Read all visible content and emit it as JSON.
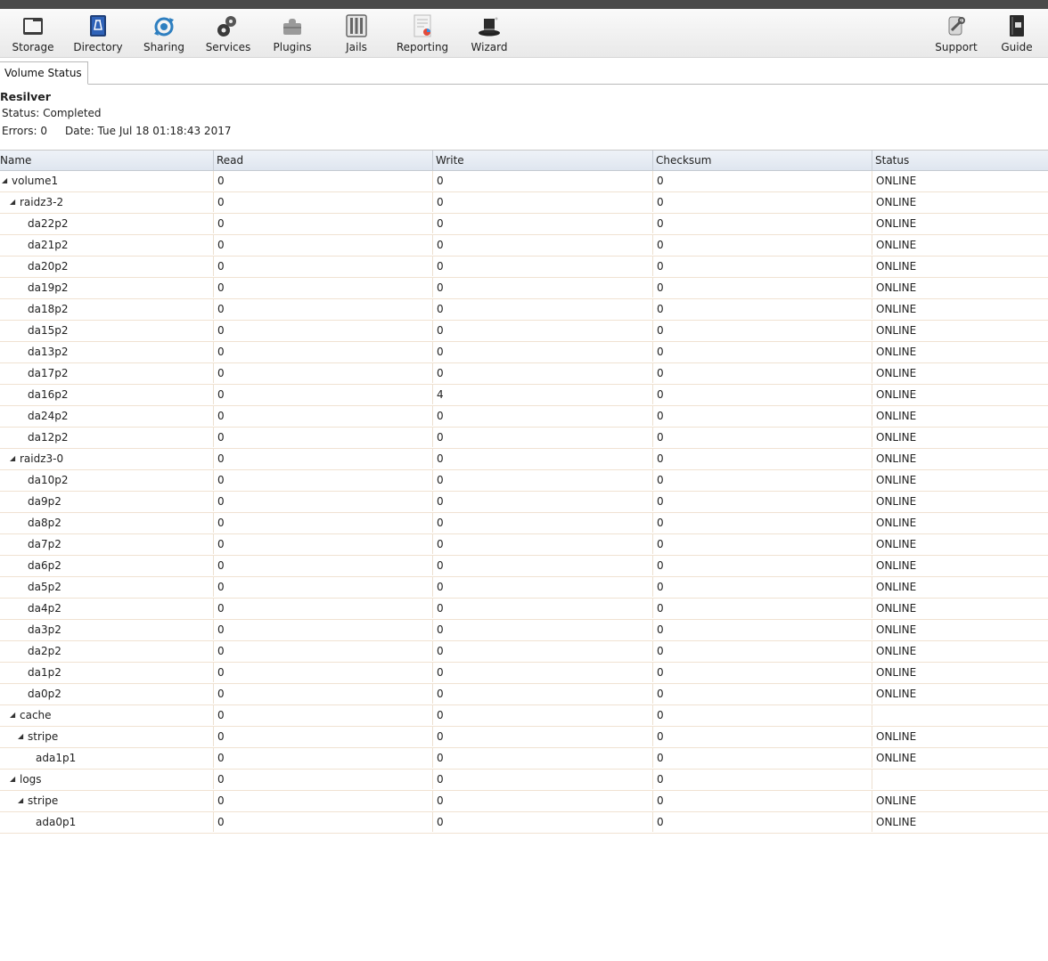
{
  "toolbar": {
    "left": [
      {
        "label": "Storage",
        "icon": "storage-icon"
      },
      {
        "label": "Directory",
        "icon": "directory-icon"
      },
      {
        "label": "Sharing",
        "icon": "sharing-icon"
      },
      {
        "label": "Services",
        "icon": "services-icon"
      },
      {
        "label": "Plugins",
        "icon": "plugins-icon"
      },
      {
        "label": "Jails",
        "icon": "jails-icon"
      },
      {
        "label": "Reporting",
        "icon": "reporting-icon"
      },
      {
        "label": "Wizard",
        "icon": "wizard-icon"
      }
    ],
    "right": [
      {
        "label": "Support",
        "icon": "support-icon"
      },
      {
        "label": "Guide",
        "icon": "guide-icon"
      }
    ]
  },
  "tab": {
    "label": "Volume Status"
  },
  "resilver": {
    "title": "Resilver",
    "status": "Status: Completed",
    "errors": "Errors: 0",
    "date": "Date: Tue Jul 18 01:18:43 2017"
  },
  "table": {
    "columns": [
      "Name",
      "Read",
      "Write",
      "Checksum",
      "Status"
    ],
    "rows": [
      {
        "name": "volume1",
        "depth": 0,
        "expandable": true,
        "read": "0",
        "write": "0",
        "checksum": "0",
        "status": "ONLINE"
      },
      {
        "name": "raidz3-2",
        "depth": 1,
        "expandable": true,
        "read": "0",
        "write": "0",
        "checksum": "0",
        "status": "ONLINE"
      },
      {
        "name": "da22p2",
        "depth": 2,
        "expandable": false,
        "read": "0",
        "write": "0",
        "checksum": "0",
        "status": "ONLINE"
      },
      {
        "name": "da21p2",
        "depth": 2,
        "expandable": false,
        "read": "0",
        "write": "0",
        "checksum": "0",
        "status": "ONLINE"
      },
      {
        "name": "da20p2",
        "depth": 2,
        "expandable": false,
        "read": "0",
        "write": "0",
        "checksum": "0",
        "status": "ONLINE"
      },
      {
        "name": "da19p2",
        "depth": 2,
        "expandable": false,
        "read": "0",
        "write": "0",
        "checksum": "0",
        "status": "ONLINE"
      },
      {
        "name": "da18p2",
        "depth": 2,
        "expandable": false,
        "read": "0",
        "write": "0",
        "checksum": "0",
        "status": "ONLINE"
      },
      {
        "name": "da15p2",
        "depth": 2,
        "expandable": false,
        "read": "0",
        "write": "0",
        "checksum": "0",
        "status": "ONLINE"
      },
      {
        "name": "da13p2",
        "depth": 2,
        "expandable": false,
        "read": "0",
        "write": "0",
        "checksum": "0",
        "status": "ONLINE"
      },
      {
        "name": "da17p2",
        "depth": 2,
        "expandable": false,
        "read": "0",
        "write": "0",
        "checksum": "0",
        "status": "ONLINE"
      },
      {
        "name": "da16p2",
        "depth": 2,
        "expandable": false,
        "read": "0",
        "write": "4",
        "checksum": "0",
        "status": "ONLINE"
      },
      {
        "name": "da24p2",
        "depth": 2,
        "expandable": false,
        "read": "0",
        "write": "0",
        "checksum": "0",
        "status": "ONLINE"
      },
      {
        "name": "da12p2",
        "depth": 2,
        "expandable": false,
        "read": "0",
        "write": "0",
        "checksum": "0",
        "status": "ONLINE"
      },
      {
        "name": "raidz3-0",
        "depth": 1,
        "expandable": true,
        "read": "0",
        "write": "0",
        "checksum": "0",
        "status": "ONLINE"
      },
      {
        "name": "da10p2",
        "depth": 2,
        "expandable": false,
        "read": "0",
        "write": "0",
        "checksum": "0",
        "status": "ONLINE"
      },
      {
        "name": "da9p2",
        "depth": 2,
        "expandable": false,
        "read": "0",
        "write": "0",
        "checksum": "0",
        "status": "ONLINE"
      },
      {
        "name": "da8p2",
        "depth": 2,
        "expandable": false,
        "read": "0",
        "write": "0",
        "checksum": "0",
        "status": "ONLINE"
      },
      {
        "name": "da7p2",
        "depth": 2,
        "expandable": false,
        "read": "0",
        "write": "0",
        "checksum": "0",
        "status": "ONLINE"
      },
      {
        "name": "da6p2",
        "depth": 2,
        "expandable": false,
        "read": "0",
        "write": "0",
        "checksum": "0",
        "status": "ONLINE"
      },
      {
        "name": "da5p2",
        "depth": 2,
        "expandable": false,
        "read": "0",
        "write": "0",
        "checksum": "0",
        "status": "ONLINE"
      },
      {
        "name": "da4p2",
        "depth": 2,
        "expandable": false,
        "read": "0",
        "write": "0",
        "checksum": "0",
        "status": "ONLINE"
      },
      {
        "name": "da3p2",
        "depth": 2,
        "expandable": false,
        "read": "0",
        "write": "0",
        "checksum": "0",
        "status": "ONLINE"
      },
      {
        "name": "da2p2",
        "depth": 2,
        "expandable": false,
        "read": "0",
        "write": "0",
        "checksum": "0",
        "status": "ONLINE"
      },
      {
        "name": "da1p2",
        "depth": 2,
        "expandable": false,
        "read": "0",
        "write": "0",
        "checksum": "0",
        "status": "ONLINE"
      },
      {
        "name": "da0p2",
        "depth": 2,
        "expandable": false,
        "read": "0",
        "write": "0",
        "checksum": "0",
        "status": "ONLINE"
      },
      {
        "name": "cache",
        "depth": 1,
        "expandable": true,
        "read": "0",
        "write": "0",
        "checksum": "0",
        "status": ""
      },
      {
        "name": "stripe",
        "depth": 2,
        "expandable": true,
        "read": "0",
        "write": "0",
        "checksum": "0",
        "status": "ONLINE"
      },
      {
        "name": "ada1p1",
        "depth": 3,
        "expandable": false,
        "read": "0",
        "write": "0",
        "checksum": "0",
        "status": "ONLINE"
      },
      {
        "name": "logs",
        "depth": 1,
        "expandable": true,
        "read": "0",
        "write": "0",
        "checksum": "0",
        "status": ""
      },
      {
        "name": "stripe",
        "depth": 2,
        "expandable": true,
        "read": "0",
        "write": "0",
        "checksum": "0",
        "status": "ONLINE"
      },
      {
        "name": "ada0p1",
        "depth": 3,
        "expandable": false,
        "read": "0",
        "write": "0",
        "checksum": "0",
        "status": "ONLINE"
      }
    ]
  }
}
